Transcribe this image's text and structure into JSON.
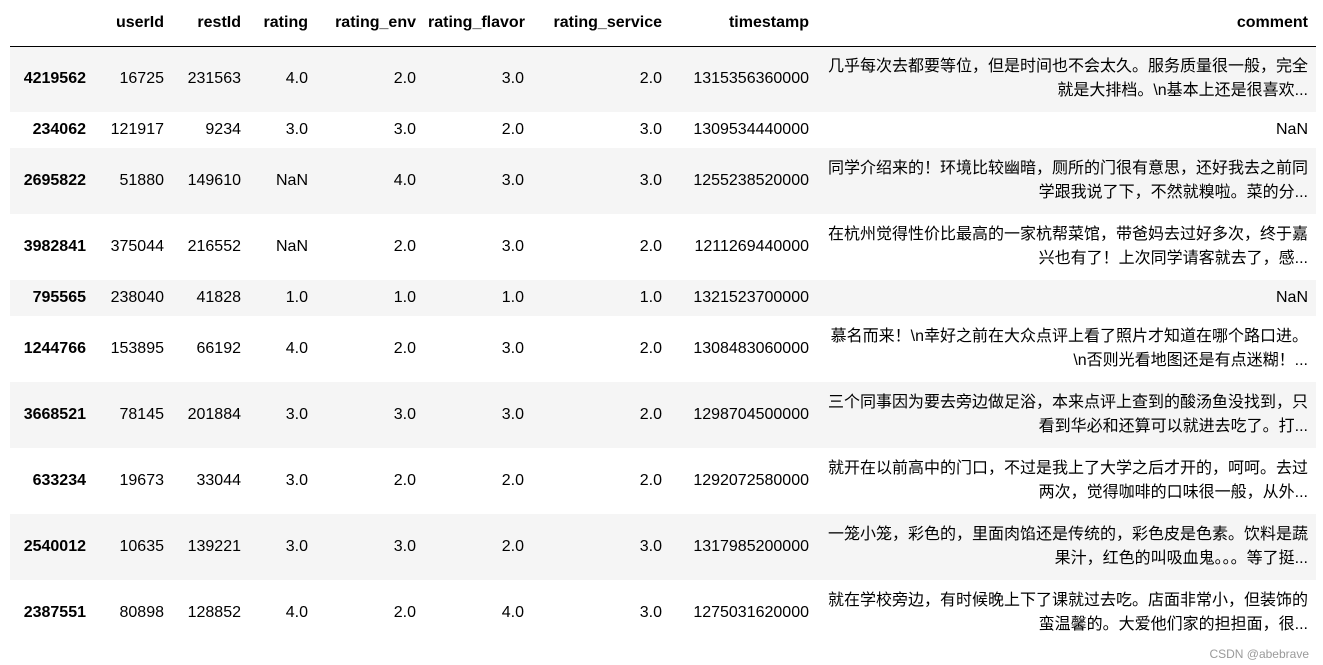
{
  "columns": [
    "",
    "userId",
    "restId",
    "rating",
    "rating_env",
    "rating_flavor",
    "rating_service",
    "timestamp",
    "comment"
  ],
  "rows": [
    {
      "index": "4219562",
      "userId": "16725",
      "restId": "231563",
      "rating": "4.0",
      "rating_env": "2.0",
      "rating_flavor": "3.0",
      "rating_service": "2.0",
      "timestamp": "1315356360000",
      "comment": "几乎每次去都要等位，但是时间也不会太久。服务质量很一般，完全就是大排档。\\n基本上还是很喜欢..."
    },
    {
      "index": "234062",
      "userId": "121917",
      "restId": "9234",
      "rating": "3.0",
      "rating_env": "3.0",
      "rating_flavor": "2.0",
      "rating_service": "3.0",
      "timestamp": "1309534440000",
      "comment": "NaN"
    },
    {
      "index": "2695822",
      "userId": "51880",
      "restId": "149610",
      "rating": "NaN",
      "rating_env": "4.0",
      "rating_flavor": "3.0",
      "rating_service": "3.0",
      "timestamp": "1255238520000",
      "comment": "同学介绍来的！环境比较幽暗，厕所的门很有意思，还好我去之前同学跟我说了下，不然就糗啦。菜的分..."
    },
    {
      "index": "3982841",
      "userId": "375044",
      "restId": "216552",
      "rating": "NaN",
      "rating_env": "2.0",
      "rating_flavor": "3.0",
      "rating_service": "2.0",
      "timestamp": "1211269440000",
      "comment": "在杭州觉得性价比最高的一家杭帮菜馆，带爸妈去过好多次，终于嘉兴也有了！上次同学请客就去了，感..."
    },
    {
      "index": "795565",
      "userId": "238040",
      "restId": "41828",
      "rating": "1.0",
      "rating_env": "1.0",
      "rating_flavor": "1.0",
      "rating_service": "1.0",
      "timestamp": "1321523700000",
      "comment": "NaN"
    },
    {
      "index": "1244766",
      "userId": "153895",
      "restId": "66192",
      "rating": "4.0",
      "rating_env": "2.0",
      "rating_flavor": "3.0",
      "rating_service": "2.0",
      "timestamp": "1308483060000",
      "comment": "慕名而来！\\n幸好之前在大众点评上看了照片才知道在哪个路口进。\\n否则光看地图还是有点迷糊！..."
    },
    {
      "index": "3668521",
      "userId": "78145",
      "restId": "201884",
      "rating": "3.0",
      "rating_env": "3.0",
      "rating_flavor": "3.0",
      "rating_service": "2.0",
      "timestamp": "1298704500000",
      "comment": "三个同事因为要去旁边做足浴，本来点评上查到的酸汤鱼没找到，只看到华必和还算可以就进去吃了。打..."
    },
    {
      "index": "633234",
      "userId": "19673",
      "restId": "33044",
      "rating": "3.0",
      "rating_env": "2.0",
      "rating_flavor": "2.0",
      "rating_service": "2.0",
      "timestamp": "1292072580000",
      "comment": "就开在以前高中的门口，不过是我上了大学之后才开的，呵呵。去过两次，觉得咖啡的口味很一般，从外..."
    },
    {
      "index": "2540012",
      "userId": "10635",
      "restId": "139221",
      "rating": "3.0",
      "rating_env": "3.0",
      "rating_flavor": "2.0",
      "rating_service": "3.0",
      "timestamp": "1317985200000",
      "comment": "一笼小笼，彩色的，里面肉馅还是传统的，彩色皮是色素。饮料是蔬果汁，红色的叫吸血鬼。。。等了挺..."
    },
    {
      "index": "2387551",
      "userId": "80898",
      "restId": "128852",
      "rating": "4.0",
      "rating_env": "2.0",
      "rating_flavor": "4.0",
      "rating_service": "3.0",
      "timestamp": "1275031620000",
      "comment": "就在学校旁边，有时候晚上下了课就过去吃。店面非常小，但装饰的蛮温馨的。大爱他们家的担担面，很..."
    }
  ],
  "watermark": "CSDN @abebrave"
}
